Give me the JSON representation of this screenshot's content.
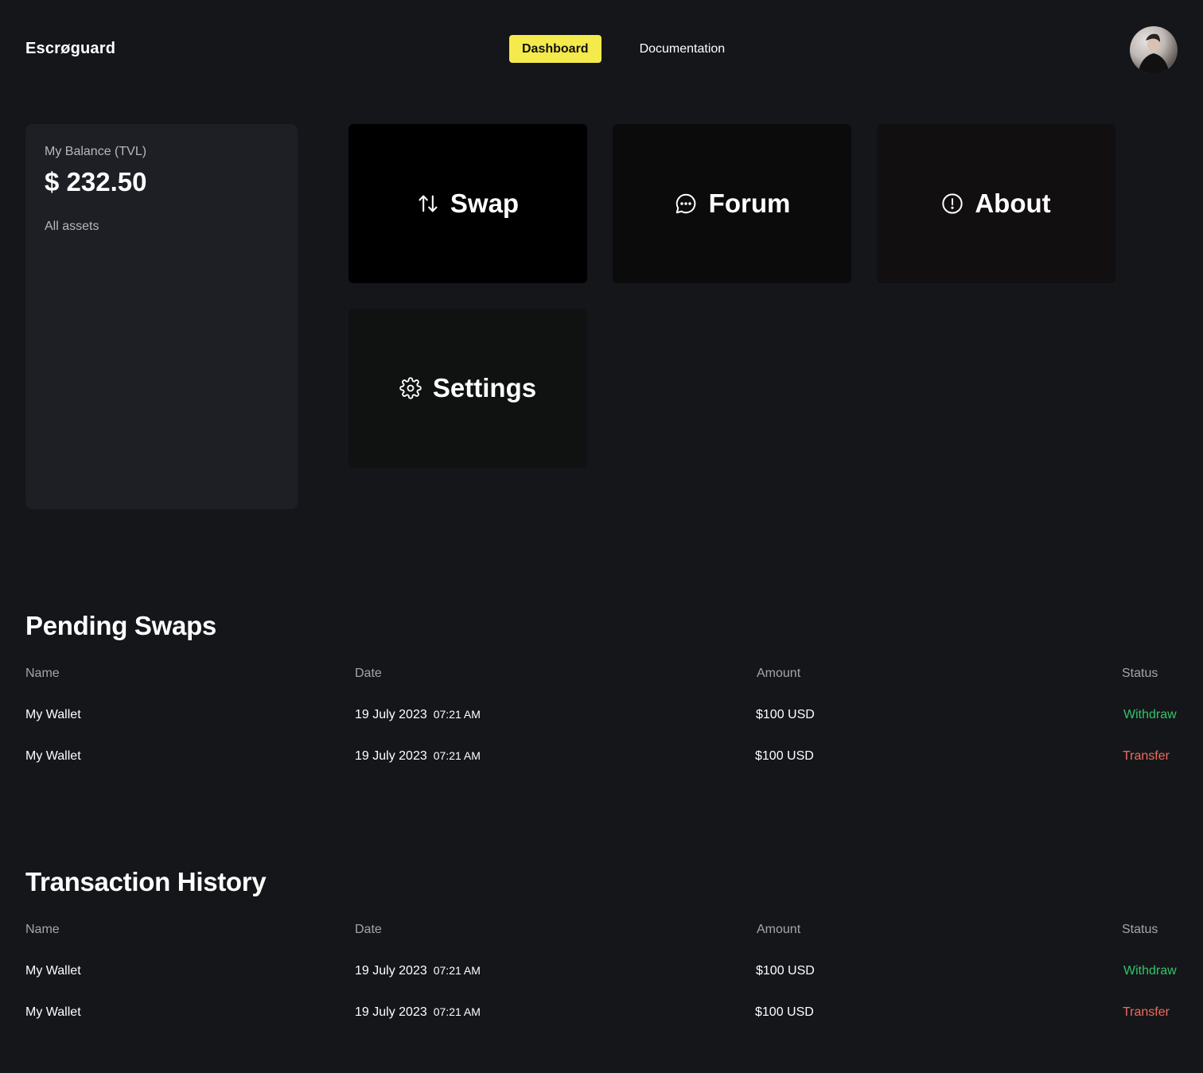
{
  "header": {
    "brand": "Escrøguard",
    "nav": [
      {
        "label": "Dashboard",
        "active": true
      },
      {
        "label": "Documentation",
        "active": false
      }
    ]
  },
  "balance": {
    "label": "My Balance (TVL)",
    "value": "$ 232.50",
    "sub_label": "All assets"
  },
  "tiles": [
    {
      "label": "Swap",
      "icon": "swap-arrows-icon"
    },
    {
      "label": "Forum",
      "icon": "chat-bubble-icon"
    },
    {
      "label": "About",
      "icon": "info-circle-icon"
    },
    {
      "label": "Settings",
      "icon": "gear-icon"
    }
  ],
  "pending_swaps": {
    "title": "Pending Swaps",
    "columns": [
      "Name",
      "Date",
      "Amount",
      "Status"
    ],
    "rows": [
      {
        "name": "My Wallet",
        "date": "19 July 2023",
        "time": "07:21 AM",
        "amount": "$100 USD",
        "status": "Withdraw"
      },
      {
        "name": "My Wallet",
        "date": "19 July 2023",
        "time": "07:21 AM",
        "amount": "$100 USD",
        "status": "Transfer"
      }
    ]
  },
  "transaction_history": {
    "title": "Transaction History",
    "columns": [
      "Name",
      "Date",
      "Amount",
      "Status"
    ],
    "rows": [
      {
        "name": "My Wallet",
        "date": "19 July 2023",
        "time": "07:21 AM",
        "amount": "$100 USD",
        "status": "Withdraw"
      },
      {
        "name": "My Wallet",
        "date": "19 July 2023",
        "time": "07:21 AM",
        "amount": "$100 USD",
        "status": "Transfer"
      }
    ]
  },
  "colors": {
    "background": "#15161a",
    "accent": "#f4ea4b",
    "withdraw": "#33c46a",
    "transfer": "#ee6b5a"
  }
}
